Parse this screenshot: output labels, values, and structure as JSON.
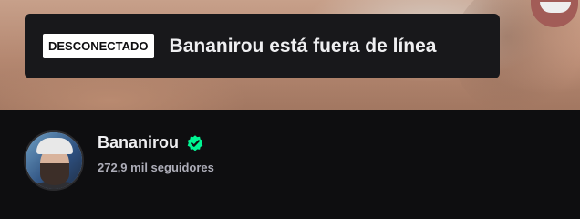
{
  "banner": {
    "status_badge": "DESCONECTADO",
    "offline_message": "Bananirou está fuera de línea"
  },
  "channel": {
    "name": "Bananirou",
    "verified_icon": "verified-check-icon",
    "followers": "272,9 mil seguidores"
  },
  "colors": {
    "background": "#0e0e10",
    "card": "#18181b",
    "verified": "#00f593",
    "text_primary": "#efeff1",
    "text_secondary": "#adadb8"
  }
}
